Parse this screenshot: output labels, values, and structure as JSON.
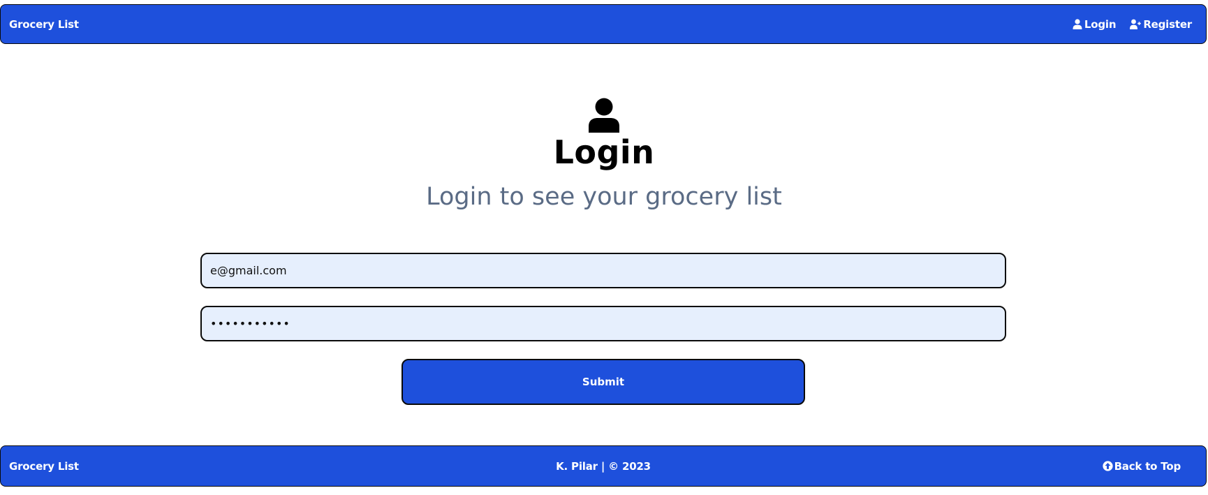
{
  "navbar": {
    "brand": "Grocery List",
    "links": [
      {
        "label": "Login",
        "icon": "user-icon"
      },
      {
        "label": "Register",
        "icon": "user-plus-icon"
      }
    ]
  },
  "hero": {
    "icon": "user-icon",
    "title": "Login",
    "subtitle": "Login to see your grocery list"
  },
  "form": {
    "email_value": "e@gmail.com",
    "password_value": "•••••••••••",
    "submit_label": "Submit"
  },
  "footer": {
    "brand": "Grocery List",
    "credit": "K. Pilar | © 2023",
    "back_to_top": "Back to Top",
    "back_to_top_icon": "circle-arrow-up-icon"
  },
  "colors": {
    "primary": "#1e50dc",
    "input_bg": "#e6effd",
    "subtitle": "#5a6b85",
    "border": "#0a0a0a"
  }
}
